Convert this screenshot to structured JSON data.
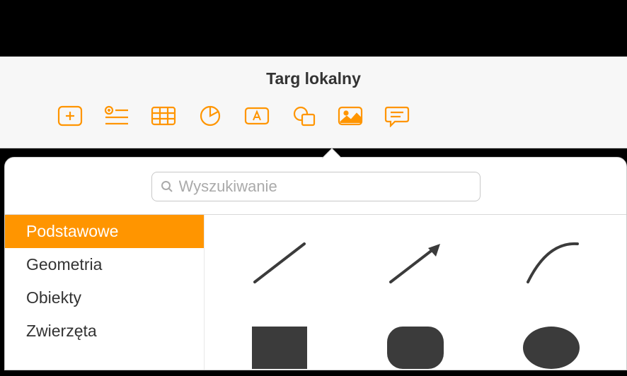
{
  "header": {
    "title": "Targ lokalny"
  },
  "toolbar": {
    "icons": [
      {
        "name": "add-box-icon"
      },
      {
        "name": "add-list-icon"
      },
      {
        "name": "table-icon"
      },
      {
        "name": "chart-icon"
      },
      {
        "name": "text-box-icon"
      },
      {
        "name": "shapes-icon"
      },
      {
        "name": "image-icon"
      },
      {
        "name": "comment-icon"
      }
    ]
  },
  "search": {
    "placeholder": "Wyszukiwanie"
  },
  "sidebar": {
    "items": [
      {
        "label": "Podstawowe",
        "selected": true
      },
      {
        "label": "Geometria",
        "selected": false
      },
      {
        "label": "Obiekty",
        "selected": false
      },
      {
        "label": "Zwierzęta",
        "selected": false
      }
    ]
  },
  "shapes": [
    {
      "name": "line-shape"
    },
    {
      "name": "arrow-shape"
    },
    {
      "name": "curve-shape"
    },
    {
      "name": "square-shape"
    },
    {
      "name": "rounded-square-shape"
    },
    {
      "name": "circle-shape"
    }
  ],
  "colors": {
    "accent": "#ff9500",
    "iconStroke": "#ff9500"
  }
}
